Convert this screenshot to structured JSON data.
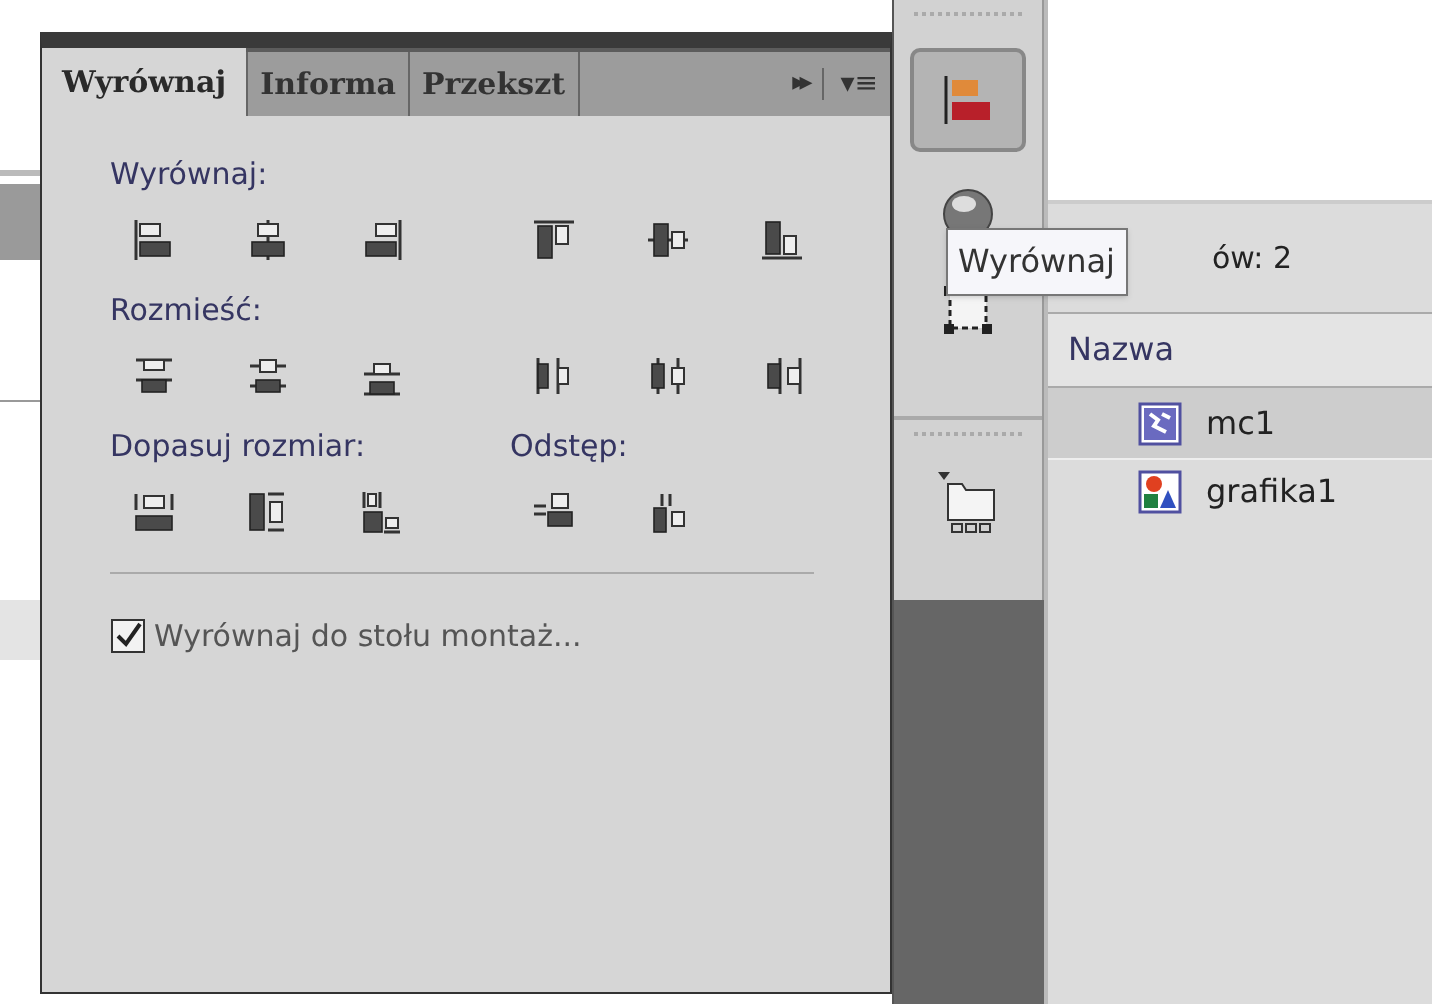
{
  "align_panel": {
    "tabs": [
      {
        "label": "Wyrównaj",
        "selected": true
      },
      {
        "label": "Informa",
        "selected": false
      },
      {
        "label": "Przekszt",
        "selected": false
      }
    ],
    "tab_controls": {
      "expand": "▸▸",
      "menu": "▾≡"
    },
    "rows": [
      {
        "groups": [
          {
            "label": "Wyrównaj:",
            "icons": [
              {
                "kind": "align-left"
              },
              {
                "kind": "align-hcenter"
              },
              {
                "kind": "align-right"
              }
            ]
          },
          {
            "icons": [
              {
                "kind": "align-top"
              },
              {
                "kind": "align-vcenter"
              },
              {
                "kind": "align-bottom"
              }
            ]
          }
        ]
      },
      {
        "groups": [
          {
            "label": "Rozmieść:",
            "icons": [
              {
                "kind": "dist-top"
              },
              {
                "kind": "dist-vcenter"
              },
              {
                "kind": "dist-bottom"
              }
            ]
          },
          {
            "icons": [
              {
                "kind": "dist-left"
              },
              {
                "kind": "dist-hcenter"
              },
              {
                "kind": "dist-right"
              }
            ]
          }
        ]
      },
      {
        "groups": [
          {
            "label": "Dopasuj rozmiar:",
            "icons": [
              {
                "kind": "match-width"
              },
              {
                "kind": "match-height"
              },
              {
                "kind": "match-both"
              }
            ]
          },
          {
            "label": "Odstęp:",
            "icons": [
              {
                "kind": "space-vertical"
              },
              {
                "kind": "space-horizontal"
              }
            ]
          }
        ]
      }
    ],
    "checkbox": {
      "label": "Wyrównaj do stołu montaż...",
      "checked": true
    }
  },
  "dock": {
    "groups": [
      [
        {
          "kind": "align",
          "selected": true
        },
        {
          "kind": "info",
          "selected": false
        },
        {
          "kind": "transform",
          "selected": false
        }
      ],
      [
        {
          "kind": "library",
          "selected": false
        }
      ]
    ]
  },
  "tooltip": "Wyrównaj",
  "library": {
    "count": "ów: 2",
    "column": "Nazwa",
    "items": [
      {
        "name": "mc1",
        "kind": "movieclip",
        "selected": true
      },
      {
        "name": "grafika1",
        "kind": "graphic",
        "selected": false
      }
    ]
  }
}
